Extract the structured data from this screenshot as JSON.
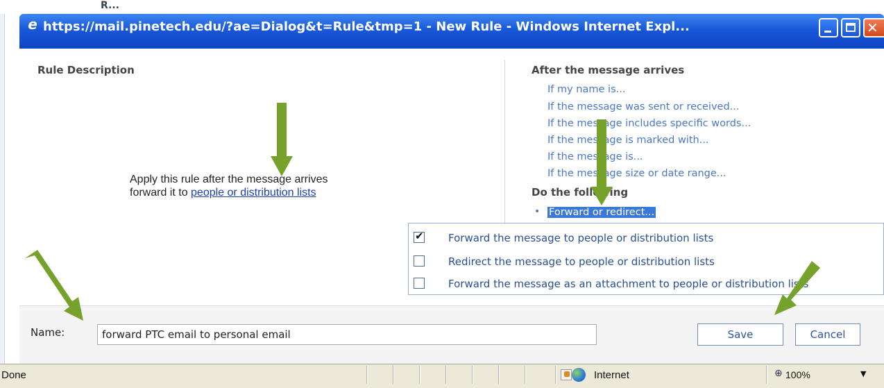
{
  "background_window": {
    "text": "R..."
  },
  "window": {
    "title": "https://mail.pinetech.edu/?ae=Dialog&t=Rule&tmp=1 - New Rule - Windows Internet Expl...",
    "icon": "ie-icon"
  },
  "rule_description": {
    "heading": "Rule Description",
    "line1": "Apply this rule after the message arrives",
    "line2_prefix": "forward it to ",
    "line2_link": "people or distribution lists"
  },
  "conditions": {
    "heading": "After the message arrives",
    "items": [
      "If my name is...",
      "If the message was sent or received...",
      "If the message includes specific words...",
      "If the message is marked with...",
      "If the message is...",
      "If the message size or date range..."
    ]
  },
  "actions": {
    "heading": "Do the following",
    "selected": "Forward or redirect..."
  },
  "dropdown": {
    "options": [
      {
        "label": "Forward the message to people or distribution lists",
        "checked": true
      },
      {
        "label": "Redirect the message to people or distribution lists",
        "checked": false
      },
      {
        "label": "Forward the message as an attachment to people or distribution lists",
        "checked": false
      }
    ]
  },
  "name_field": {
    "label": "Name:",
    "value": "forward PTC email to personal email"
  },
  "buttons": {
    "save": "Save",
    "cancel": "Cancel"
  },
  "statusbar": {
    "status": "Done",
    "zone": "Internet",
    "zoom": "100%"
  },
  "colors": {
    "titlebar": "#1858d8",
    "link": "#4a78c8",
    "selection": "#3b79d8",
    "arrow": "#76a12a"
  }
}
